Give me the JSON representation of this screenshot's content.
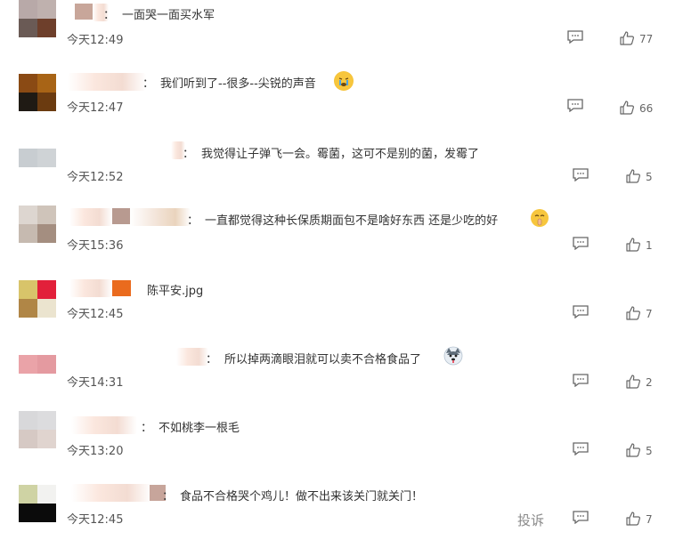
{
  "comments": [
    {
      "text": "一面哭一面买水军",
      "time": "今天12:49",
      "likes": "77",
      "avatar": [
        "#b8a9a8",
        "#bfb1ae",
        "#6a5a55",
        "#6e3f2b"
      ]
    },
    {
      "text": "我们听到了--很多--尖锐的声音",
      "time": "今天12:47",
      "likes": "66",
      "emoji": "crying-face-icon",
      "avatar": [
        "#8a4a14",
        "#a86416",
        "#1f1a14",
        "#6b3b10"
      ]
    },
    {
      "text": "我觉得让子弹飞一会。霉菌，这可不是别的菌，发霉了",
      "time": "今天12:52",
      "likes": "5",
      "avatar": [
        "#c8cdd1",
        "#cfd3d6",
        "#ffffff",
        "#ffffff"
      ]
    },
    {
      "text": "一直都觉得这种长保质期面包不是啥好东西 还是少吃的好",
      "time": "今天15:36",
      "likes": "1",
      "emoji": "shushing-face-icon",
      "avatar": [
        "#ddd6d0",
        "#cfc4ba",
        "#c6bab0",
        "#a48e80"
      ]
    },
    {
      "text": "陈平安.jpg",
      "time": "今天12:45",
      "likes": "7",
      "avatar": [
        "#d8c46a",
        "#e2203a",
        "#b08646",
        "#ebe4cf"
      ]
    },
    {
      "text": "所以掉两滴眼泪就可以卖不合格食品了",
      "time": "今天14:31",
      "likes": "2",
      "emoji": "husky-dog-icon",
      "avatar": [
        "#eaa3a8",
        "#e49aa0",
        "#ffffff",
        "#ffffff"
      ]
    },
    {
      "text": "不如桃李一根毛",
      "time": "今天13:20",
      "likes": "5",
      "avatar": [
        "#d8d8da",
        "#dcdcde",
        "#d6c9c4",
        "#e0d4cf"
      ]
    },
    {
      "text": "食品不合格哭个鸡儿！做不出来该关门就关门！",
      "time": "今天12:45",
      "likes": "7",
      "avatar": [
        "#cfd3a4",
        "#f2f2f0",
        "#0b0b0b",
        "#0b0b0b"
      ]
    }
  ],
  "report_label": "投诉",
  "colon": "："
}
